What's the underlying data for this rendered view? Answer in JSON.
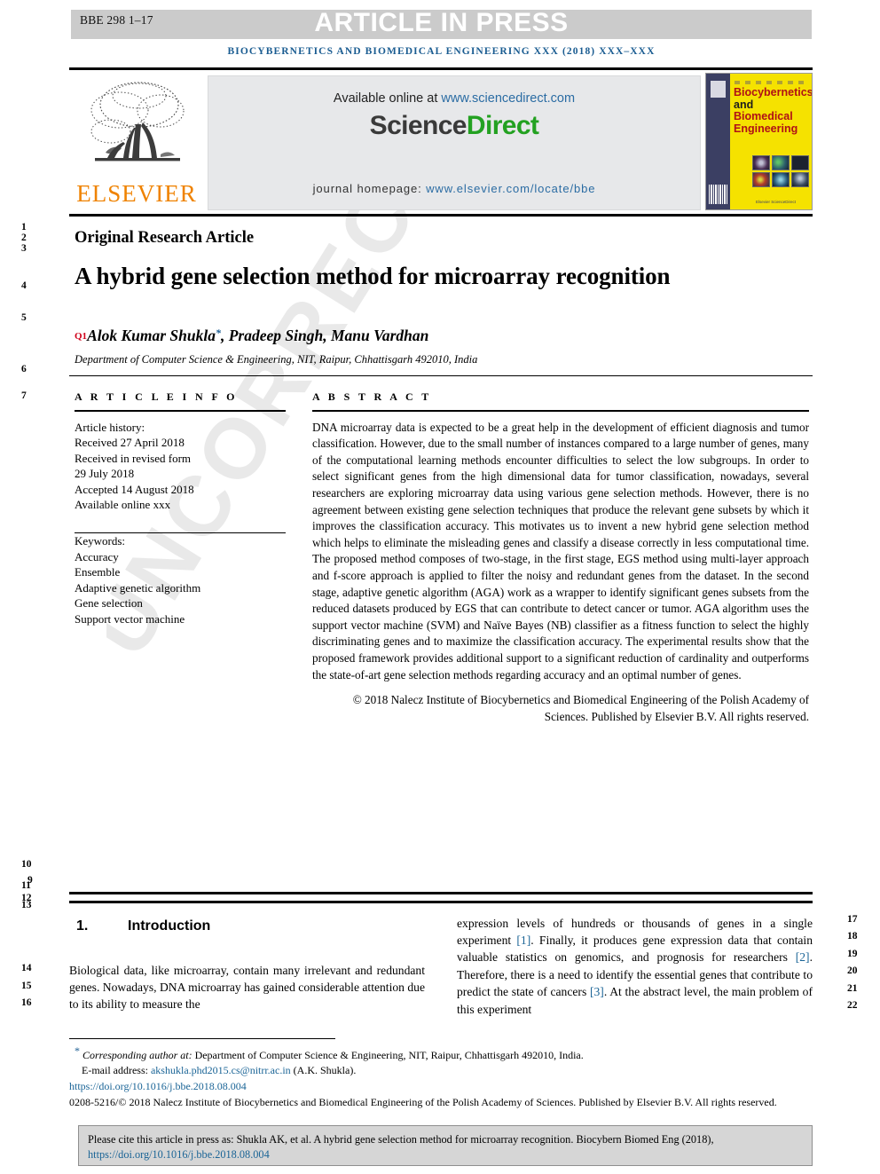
{
  "header": {
    "bbe_code": "BBE 298 1–17",
    "article_in_press": "ARTICLE IN PRESS",
    "journal_line": "BIOCYBERNETICS AND BIOMEDICAL ENGINEERING XXX (2018) XXX–XXX"
  },
  "masthead": {
    "elsevier_wordmark": "ELSEVIER",
    "available_prefix": "Available online at ",
    "sciencedirect_url": "www.sciencedirect.com",
    "sciencedirect_logo_part1": "Science",
    "sciencedirect_logo_part2": "Direct",
    "homepage_prefix": "journal homepage: ",
    "homepage_url": "www.elsevier.com/locate/bbe",
    "cover": {
      "title_line1": "Biocybernetics",
      "title_line2_a": "and ",
      "title_line2_b": "Biomedical",
      "title_line3": "Engineering",
      "publisher_note": "Elsevier ScienceDirect"
    }
  },
  "article": {
    "kind": "Original Research Article",
    "title": "A hybrid gene selection method for microarray recognition",
    "query_marker": "Q1",
    "authors": "Alok Kumar Shukla",
    "authors_rest": ", Pradeep Singh, Manu Vardhan",
    "corresponding_star": "*",
    "affiliation": "Department of Computer Science & Engineering, NIT, Raipur, Chhattisgarh 492010, India"
  },
  "article_info": {
    "heading": "A R T I C L E   I N F O",
    "history_label": "Article history:",
    "history": [
      "Received 27 April 2018",
      "Received in revised form",
      "29 July 2018",
      "Accepted 14 August 2018",
      "Available online xxx"
    ],
    "keywords_label": "Keywords:",
    "keywords": [
      "Accuracy",
      "Ensemble",
      "Adaptive genetic algorithm",
      "Gene selection",
      "Support vector machine"
    ]
  },
  "abstract": {
    "heading": "A B S T R A C T",
    "text": "DNA microarray data is expected to be a great help in the development of efficient diagnosis and tumor classification. However, due to the small number of instances compared to a large number of genes, many of the computational learning methods encounter difficulties to select the low subgroups. In order to select significant genes from the high dimensional data for tumor classification, nowadays, several researchers are exploring microarray data using various gene selection methods. However, there is no agreement between existing gene selection techniques that produce the relevant gene subsets by which it improves the classification accuracy. This motivates us to invent a new hybrid gene selection method which helps to eliminate the misleading genes and classify a disease correctly in less computational time. The proposed method composes of two-stage, in the first stage, EGS method using multi-layer approach and f-score approach is applied to filter the noisy and redundant genes from the dataset. In the second stage, adaptive genetic algorithm (AGA) work as a wrapper to identify significant genes subsets from the reduced datasets produced by EGS that can contribute to detect cancer or tumor. AGA algorithm uses the support vector machine (SVM) and Naïve Bayes (NB) classifier as a fitness function to select the highly discriminating genes and to maximize the classification accuracy. The experimental results show that the proposed framework provides additional support to a significant reduction of cardinality and outperforms the state-of-art gene selection methods regarding accuracy and an optimal number of genes.",
    "copyright": "© 2018 Nalecz Institute of Biocybernetics and Biomedical Engineering of the Polish Academy of Sciences. Published by Elsevier B.V. All rights reserved."
  },
  "introduction": {
    "number": "1.",
    "title": "Introduction",
    "left_paragraph": "Biological data, like microarray, contain many irrelevant and redundant genes. Nowadays, DNA microarray has gained considerable attention due to its ability to measure the",
    "right_parts": {
      "p1": "expression levels of hundreds or thousands of genes in a single experiment ",
      "r1": "[1]",
      "p2": ". Finally, it produces gene expression data that contain valuable statistics on genomics, and prognosis for researchers ",
      "r2": "[2]",
      "p3": ". Therefore, there is a need to identify the essential genes that contribute to predict the state of cancers ",
      "r3": "[3]",
      "p4": ". At the abstract level, the main problem of this experiment"
    }
  },
  "footnotes": {
    "corresponding_star": "*",
    "corresponding_label": "Corresponding author at:",
    "corresponding_text": " Department of Computer Science & Engineering, NIT, Raipur, Chhattisgarh 492010, India.",
    "email_label": "E-mail address:",
    "email": "akshukla.phd2015.cs@nitrr.ac.in",
    "email_suffix": " (A.K. Shukla).",
    "doi": "https://doi.org/10.1016/j.bbe.2018.08.004",
    "issn_line": "0208-5216/© 2018 Nalecz Institute of Biocybernetics and Biomedical Engineering of the Polish Academy of Sciences. Published by Elsevier B.V. All rights reserved."
  },
  "cite_box": {
    "text": "Please cite this article in press as: Shukla AK, et al. A hybrid gene selection method for microarray recognition. Biocybern Biomed Eng (2018), ",
    "doi": "https://doi.org/10.1016/j.bbe.2018.08.004"
  },
  "watermark": "UNCORRECTED PROOF",
  "line_numbers": {
    "left": [
      "1",
      "2",
      "3",
      "4",
      "5",
      "6",
      "7",
      "10",
      "11",
      "9",
      "12",
      "13",
      "14",
      "15",
      "16"
    ],
    "right": [
      "17",
      "18",
      "19",
      "20",
      "21",
      "22"
    ]
  },
  "colors": {
    "journal_blue": "#1a5c91",
    "link_blue": "#1a6496",
    "sciencedirect_green": "#23a121",
    "elsevier_orange": "#ef8200",
    "query_red": "#d0021b",
    "bar_gray": "#cbcbcb"
  }
}
